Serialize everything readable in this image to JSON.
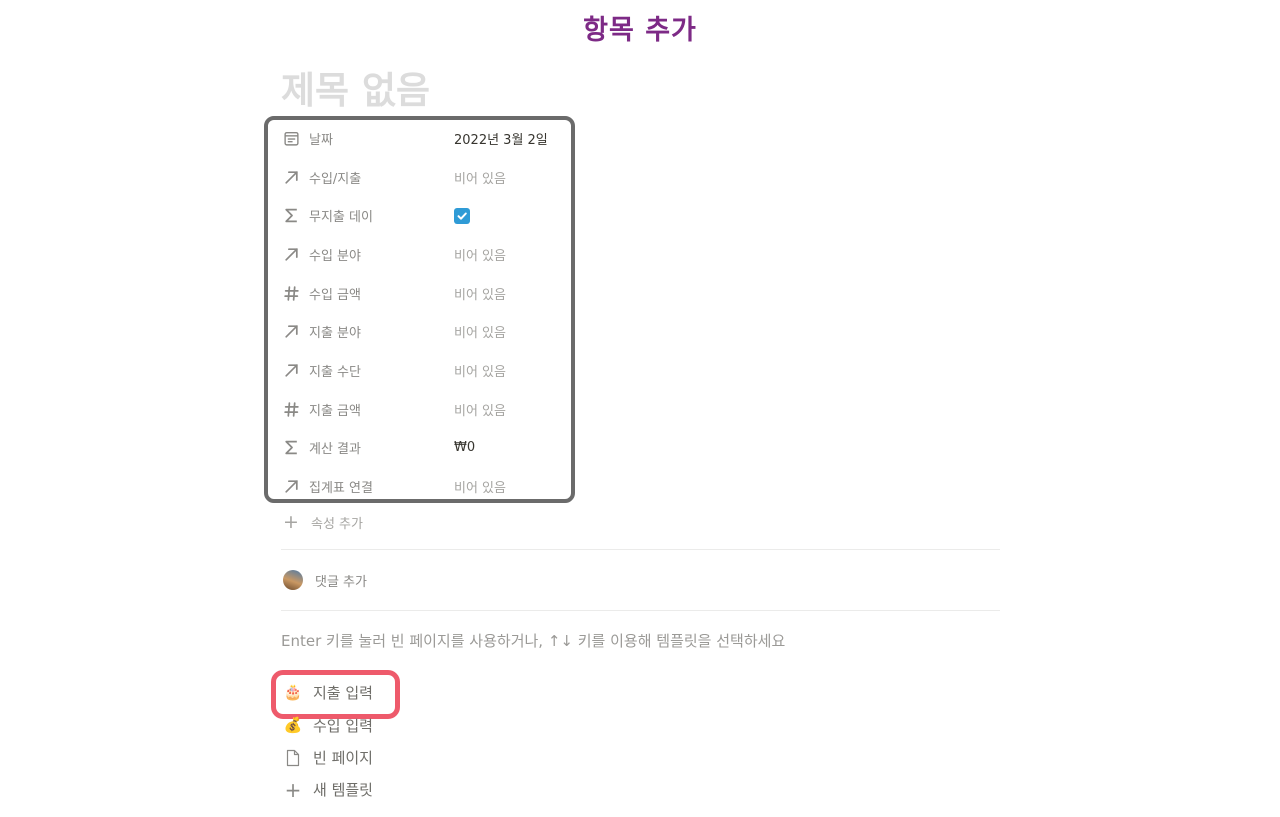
{
  "header_caption": "항목 추가",
  "page": {
    "title": "제목 없음"
  },
  "properties": [
    {
      "icon": "calendar-icon",
      "label": "날짜",
      "value": "2022년 3월 2일",
      "filled": true
    },
    {
      "icon": "relation-arrow-icon",
      "label": "수입/지출",
      "value": "비어 있음",
      "filled": false
    },
    {
      "icon": "sigma-icon",
      "label": "무지출 데이",
      "value": "",
      "checkbox": true
    },
    {
      "icon": "relation-arrow-icon",
      "label": "수입 분야",
      "value": "비어 있음",
      "filled": false
    },
    {
      "icon": "hash-icon",
      "label": "수입 금액",
      "value": "비어 있음",
      "filled": false
    },
    {
      "icon": "relation-arrow-icon",
      "label": "지출 분야",
      "value": "비어 있음",
      "filled": false
    },
    {
      "icon": "relation-arrow-icon",
      "label": "지출 수단",
      "value": "비어 있음",
      "filled": false
    },
    {
      "icon": "hash-icon",
      "label": "지출 금액",
      "value": "비어 있음",
      "filled": false
    },
    {
      "icon": "sigma-icon",
      "label": "계산 결과",
      "value": "₩0",
      "filled": true
    },
    {
      "icon": "relation-arrow-icon",
      "label": "집계표 연결",
      "value": "비어 있음",
      "filled": false
    }
  ],
  "add_property_label": "속성 추가",
  "comment_placeholder": "댓글 추가",
  "template_hint": "Enter 키를 눌러 빈 페이지를 사용하거나, ↑↓ 키를 이용해 템플릿을 선택하세요",
  "templates": [
    {
      "icon": "cake-icon",
      "emoji": "🎂",
      "label": "지출 입력"
    },
    {
      "icon": "money-bag-icon",
      "emoji": "💰",
      "label": "수입 입력"
    },
    {
      "icon": "blank-page-icon",
      "emoji": "",
      "label": "빈 페이지"
    },
    {
      "icon": "plus-icon",
      "emoji": "+",
      "label": "새 템플릿"
    }
  ],
  "colors": {
    "caption": "#7d2a86",
    "properties_outline": "#6b6b6b",
    "template_outline": "#ee5a6b",
    "checkbox": "#2f9bd6"
  }
}
